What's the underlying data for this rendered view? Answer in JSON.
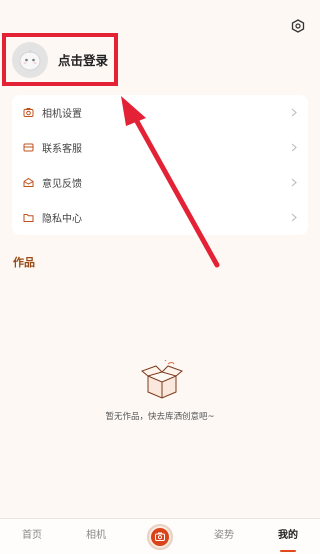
{
  "header": {
    "login_text": "点击登录"
  },
  "menu": {
    "items": [
      {
        "label": "相机设置",
        "icon": "camera-settings-icon"
      },
      {
        "label": "联系客服",
        "icon": "customer-service-icon"
      },
      {
        "label": "意见反馈",
        "icon": "feedback-icon"
      },
      {
        "label": "隐私中心",
        "icon": "privacy-folder-icon"
      }
    ]
  },
  "works": {
    "title": "作品",
    "empty_text": "暂无作品，快去库洒创意吧~"
  },
  "tabbar": {
    "tabs": [
      {
        "label": "首页"
      },
      {
        "label": "相机"
      },
      {
        "label": "姿势"
      },
      {
        "label": "我的"
      }
    ]
  },
  "colors": {
    "accent": "#e04a1a",
    "annotation_red": "#e32236",
    "works_title": "#9a4a16",
    "background": "#fdf8f4"
  }
}
